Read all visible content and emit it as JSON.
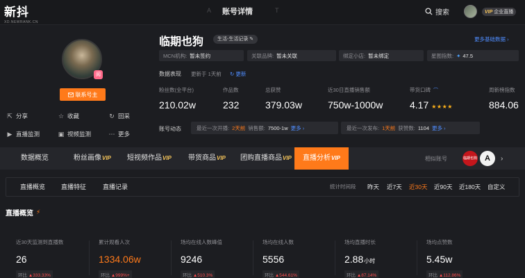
{
  "app": {
    "logo": "新抖",
    "logo_sub": "XD.NEWRANK.CN",
    "page_title": "账号详情",
    "search_label": "搜索",
    "vip_badge": "VIP",
    "vip_label": "企业直播"
  },
  "profile": {
    "contact_button": "联系号主",
    "avatar_tag": "阅",
    "actions": [
      {
        "label": "分享",
        "icon": "share-icon"
      },
      {
        "label": "收藏",
        "icon": "star-outline-icon"
      },
      {
        "label": "回采",
        "icon": "refresh-icon"
      },
      {
        "label": "直播监测",
        "icon": "live-monitor-icon"
      },
      {
        "label": "视频监测",
        "icon": "video-monitor-icon"
      },
      {
        "label": "更多",
        "icon": "more-icon"
      }
    ],
    "name": "临期也狗",
    "category_tag": "生活-生活记录",
    "more_info_link": "更多基础数据",
    "info": [
      {
        "key": "MCN机构:",
        "value": "暂未签约"
      },
      {
        "key": "关联品牌:",
        "value": "暂未关联"
      },
      {
        "key": "绑定小店:",
        "value": "暂未绑定"
      },
      {
        "key": "星图指数:",
        "value": "47.5"
      }
    ],
    "performance_label": "数据表现",
    "performance_time": "更新于 1天前",
    "refresh_label": "更新",
    "stats": [
      {
        "label": "粉丝数(全平台)",
        "value": "210.02w"
      },
      {
        "label": "作品数",
        "value": "232"
      },
      {
        "label": "总获赞",
        "value": "379.03w"
      },
      {
        "label": "近30日直播销售额",
        "value": "750w-1000w"
      },
      {
        "label": "带货口碑",
        "value": "4.17",
        "stars": "★★★★"
      },
      {
        "label": "周新榜指数",
        "value": "884.06"
      }
    ],
    "dynamics_label": "账号动态",
    "dynamics": {
      "live_prefix": "最近一次开播:",
      "live_time": "2天前",
      "live_sales_key": "销售额:",
      "live_sales": "7500-1w",
      "more1": "更多",
      "publish_prefix": "最近一次发布:",
      "publish_time": "1天前",
      "likes_key": "获赞数:",
      "likes": "1104",
      "more2": "更多"
    }
  },
  "tabs": {
    "items": [
      {
        "label": "数据概览",
        "vip": ""
      },
      {
        "label": "粉丝画像",
        "vip": "VIP"
      },
      {
        "label": "短视频作品",
        "vip": "VIP"
      },
      {
        "label": "带货商品",
        "vip": "VIP"
      },
      {
        "label": "团购直播商品",
        "vip": "VIP"
      },
      {
        "label": "直播分析",
        "vip": "VIP"
      }
    ],
    "active_index": 5,
    "similar_label": "相似账号",
    "similar_accounts": [
      {
        "text": "临期也狗",
        "color": "#c4161c"
      },
      {
        "text": "A",
        "color": "#f2f2f2"
      }
    ]
  },
  "subtabs": {
    "items": [
      "直播概览",
      "直播特征",
      "直播记录"
    ],
    "range_label": "统计时间段",
    "ranges": [
      "昨天",
      "近7天",
      "近30天",
      "近90天",
      "近180天",
      "自定义"
    ],
    "active_range": 2
  },
  "overview": {
    "title": "直播概览",
    "items": [
      {
        "label": "近30天监测到直播数",
        "value": "26",
        "unit": "",
        "change": "333.33%",
        "highlight": false
      },
      {
        "label": "累计观看人次",
        "value": "1334.06w",
        "unit": "",
        "change": "999%+",
        "highlight": true
      },
      {
        "label": "场均在线人数峰值",
        "value": "9246",
        "unit": "",
        "change": "510.3%",
        "highlight": false
      },
      {
        "label": "场均在线人数",
        "value": "5556",
        "unit": "",
        "change": "544.61%",
        "highlight": false
      },
      {
        "label": "场均直播时长",
        "value": "2.88",
        "unit": "小时",
        "change": "87.14%",
        "highlight": false
      },
      {
        "label": "场均点赞数",
        "value": "5.45w",
        "unit": "",
        "change": "112.86%",
        "highlight": false
      }
    ],
    "change_prefix": "环比"
  },
  "colors": {
    "accent": "#ff7a1a",
    "link": "#4f8dff",
    "background": "#1c1d21",
    "up": "#ff4d4f"
  }
}
